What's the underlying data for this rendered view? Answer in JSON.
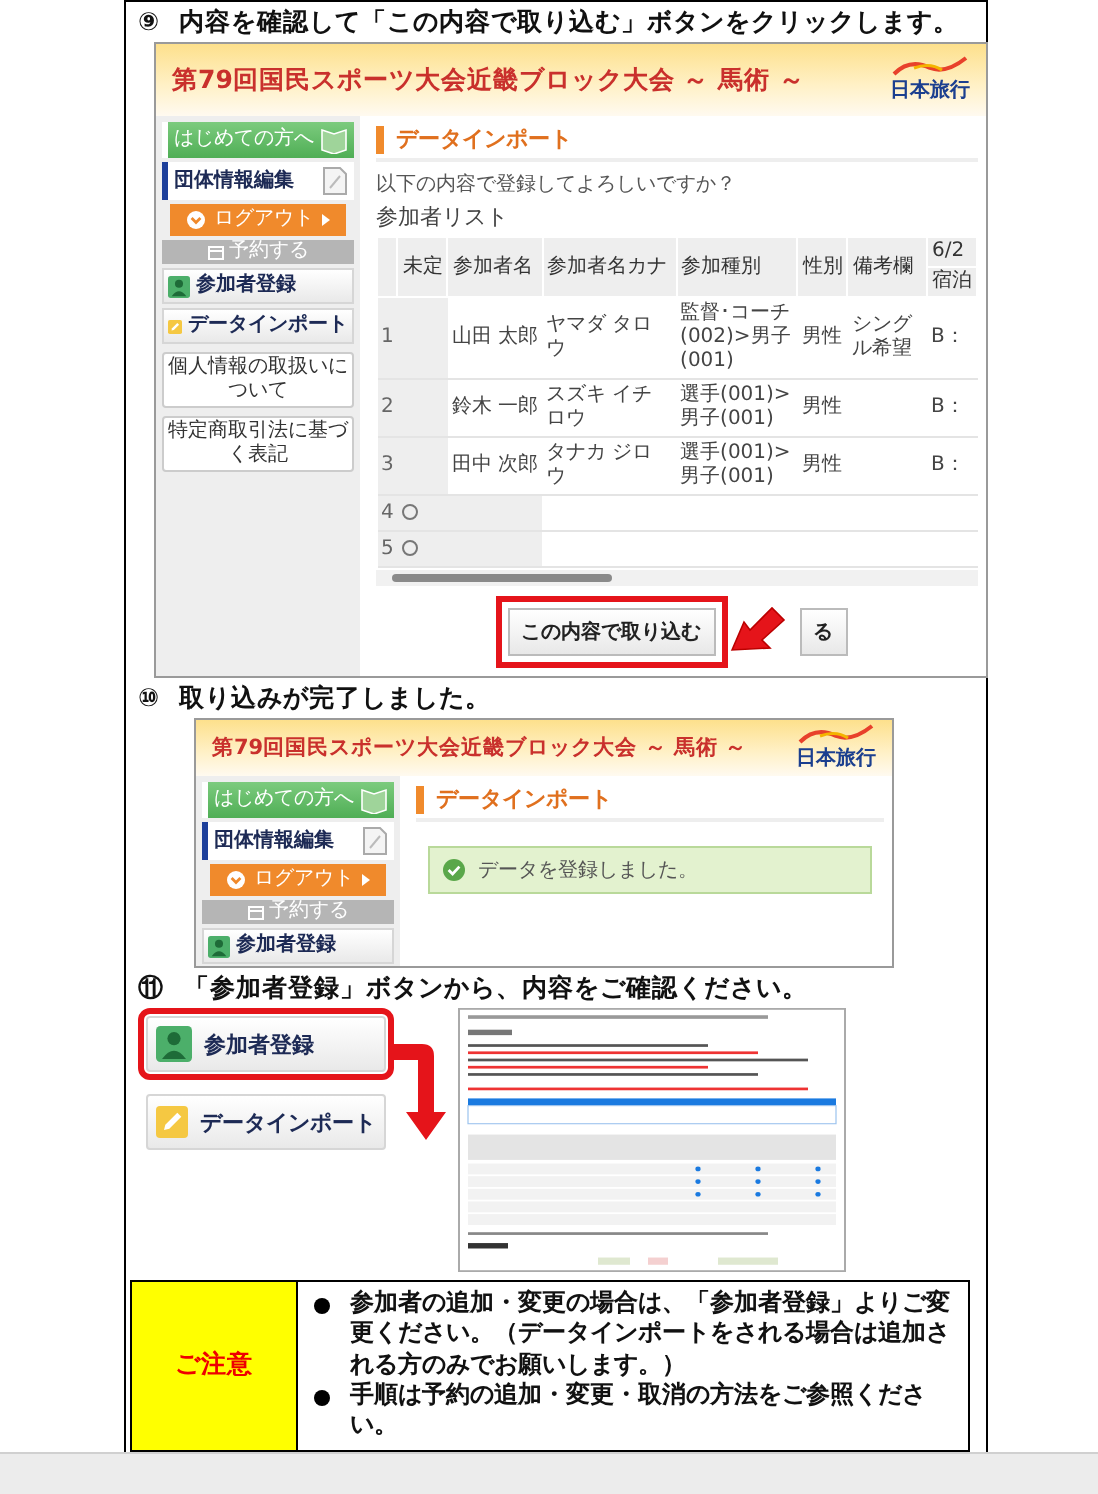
{
  "step_9": {
    "number": "⑨",
    "text": "内容を確認して「この内容で取り込む」ボタンをクリックします。",
    "screen": {
      "banner": {
        "title": "第79回国民スポーツ大会近畿ブロック大会 ～ 馬術 ～",
        "logo": "日本旅行"
      },
      "sidebar": [
        {
          "kind": "guide",
          "label": "はじめての方へ"
        },
        {
          "kind": "edit",
          "label": "団体情報編集"
        },
        {
          "kind": "logout",
          "label": "ログアウト"
        },
        {
          "kind": "section",
          "label": "予約する"
        },
        {
          "kind": "participants",
          "label": "参加者登録"
        },
        {
          "kind": "import",
          "label": "データインポート"
        },
        {
          "kind": "link",
          "label": "個人情報の取扱いについて"
        },
        {
          "kind": "link",
          "label": "特定商取引法に基づく表記"
        }
      ],
      "heading": "データインポート",
      "question": "以下の内容で登録してよろしいですか？",
      "list_title": "参加者リスト",
      "table": {
        "columns": [
          "未定",
          "参加者名",
          "参加者名カナ",
          "参加種別",
          "性別",
          "備考欄",
          "6/2"
        ],
        "subheader": "宿泊",
        "rows": [
          {
            "kind": "entry",
            "no": "1",
            "name": "山田 太郎",
            "kana": "ヤマダ タロウ",
            "type": "監督･コーチ(002)>男子(001)",
            "gender": "男性",
            "remarks": "シングル希望",
            "day": "B："
          },
          {
            "kind": "entry",
            "no": "2",
            "name": "鈴木 一郎",
            "kana": "スズキ イチロウ",
            "type": "選手(001)>男子(001)",
            "gender": "男性",
            "day": "B："
          },
          {
            "kind": "entry",
            "no": "3",
            "name": "田中 次郎",
            "kana": "タナカ ジロウ",
            "type": "選手(001)>男子(001)",
            "gender": "男性",
            "day": "B："
          },
          {
            "kind": "blank",
            "no": "4",
            "selected": false
          },
          {
            "kind": "blank",
            "no": "5",
            "selected": false
          }
        ]
      },
      "buttons": [
        {
          "label": "この内容で取り込む",
          "highlighted": true
        },
        {
          "label": "る",
          "highlighted": false
        }
      ]
    }
  },
  "step_10": {
    "number": "⑩",
    "text": "取り込みが完了しました。",
    "screen": {
      "banner": {
        "title": "第79回国民スポーツ大会近畿ブロック大会 ～ 馬術 ～",
        "logo": "日本旅行"
      },
      "sidebar": [
        {
          "kind": "guide",
          "label": "はじめての方へ"
        },
        {
          "kind": "edit",
          "label": "団体情報編集"
        },
        {
          "kind": "logout",
          "label": "ログアウト"
        },
        {
          "kind": "section",
          "label": "予約する"
        },
        {
          "kind": "participants",
          "label": "参加者登録"
        }
      ],
      "heading": "データインポート",
      "message": "データを登録しました。"
    }
  },
  "step_11": {
    "number": "⑪",
    "text": "「参加者登録」ボタンから、内容をご確認ください。",
    "buttons": [
      {
        "kind": "participants",
        "label": "参加者登録",
        "highlighted": true
      },
      {
        "kind": "import",
        "label": "データインポート",
        "highlighted": false
      }
    ]
  },
  "notice": {
    "label": "ご注意",
    "bullets": [
      "参加者の追加・変更の場合は、「参加者登録」よりご変更ください。（データインポートをされる場合は追加される方のみでお願いします。）",
      "手順は予約の追加・変更・取消の方法をご参照ください。"
    ]
  }
}
